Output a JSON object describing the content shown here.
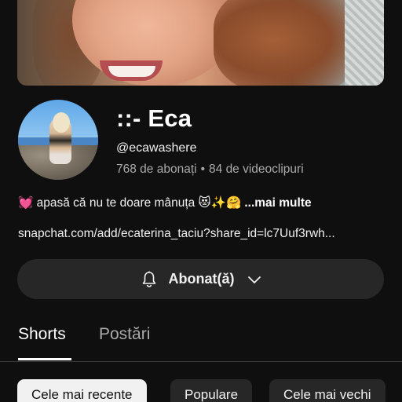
{
  "channel": {
    "name": "::- Eca",
    "handle": "@ecawashere",
    "subscribers": "768 de abonați",
    "separator": "•",
    "videos": "84 de videoclipuri",
    "description": "💓 apasă că nu te doare mânuța 😻✨🤗",
    "more_label": "...mai multe",
    "link": "snapchat.com/add/ecaterina_taciu?share_id=lc7Uuf3rwh..."
  },
  "subscribe_button": {
    "label": "Abonat(ă)",
    "icon": "bell-icon",
    "chevron_icon": "chevron-down-icon"
  },
  "tabs": [
    {
      "label": "Shorts",
      "active": true
    },
    {
      "label": "Postări",
      "active": false
    }
  ],
  "filters": [
    {
      "label": "Cele mai recente",
      "selected": true
    },
    {
      "label": "Populare",
      "selected": false
    },
    {
      "label": "Cele mai vechi",
      "selected": false
    }
  ],
  "colors": {
    "background": "#0f0f0f",
    "button_bg": "#272727",
    "selected_chip_bg": "#f1f1f1",
    "secondary_text": "#aaaaaa"
  }
}
